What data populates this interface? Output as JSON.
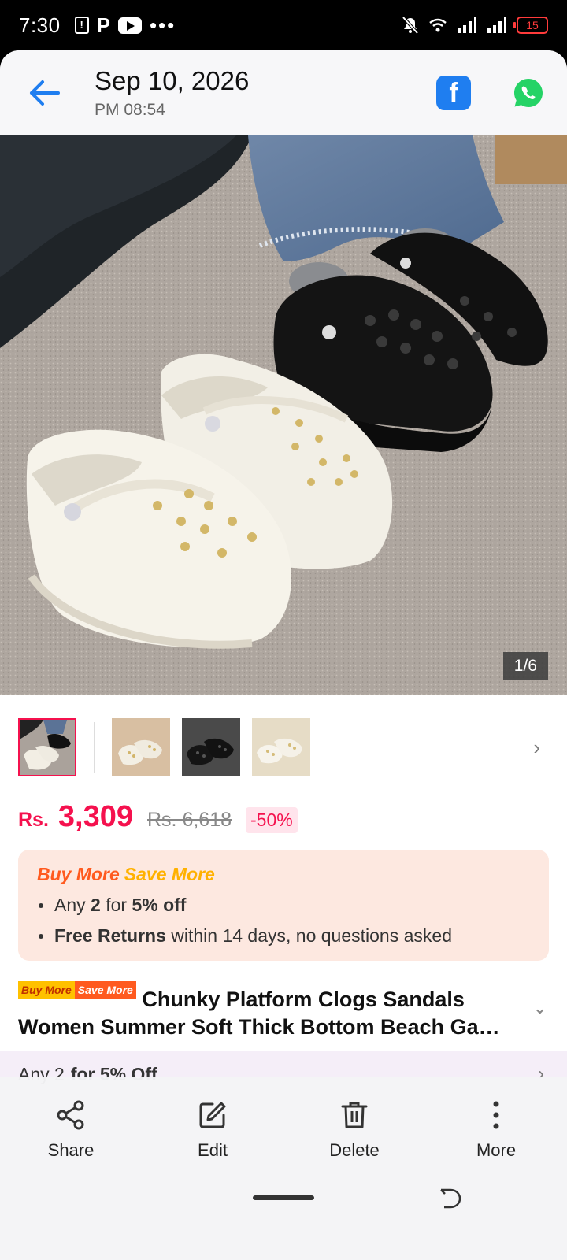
{
  "status_bar": {
    "time": "7:30",
    "p_label": "P",
    "battery": "15"
  },
  "header": {
    "date": "Sep 10, 2026",
    "time": "PM 08:54",
    "facebook_glyph": "f"
  },
  "hero": {
    "counter": "1/6"
  },
  "thumbnails": {
    "count": 4,
    "active_index": 0
  },
  "price": {
    "currency": "Rs.",
    "current": "3,309",
    "original": "Rs. 6,618",
    "discount": "-50%"
  },
  "promo": {
    "title_part1": "Buy More",
    "title_part2": "Save More",
    "line1_pre": "Any ",
    "line1_bold1": "2",
    "line1_mid": " for ",
    "line1_bold2": "5% off",
    "line2_bold": "Free Returns",
    "line2_rest": " within 14 days, no questions asked"
  },
  "product": {
    "badge_part1": "Buy More",
    "badge_part2": "Save More",
    "title": "Chunky Platform Clogs Sandals Women Summer Soft Thick Bottom Beach Ga…"
  },
  "offer_bar": {
    "pre": "Any 2",
    "bold": "for 5% Off"
  },
  "actions": {
    "share": "Share",
    "edit": "Edit",
    "delete": "Delete",
    "more": "More"
  },
  "colors": {
    "accent": "#f5114e",
    "back_arrow": "#1f7ef0",
    "facebook": "#1f7ef0",
    "whatsapp": "#25d366"
  }
}
